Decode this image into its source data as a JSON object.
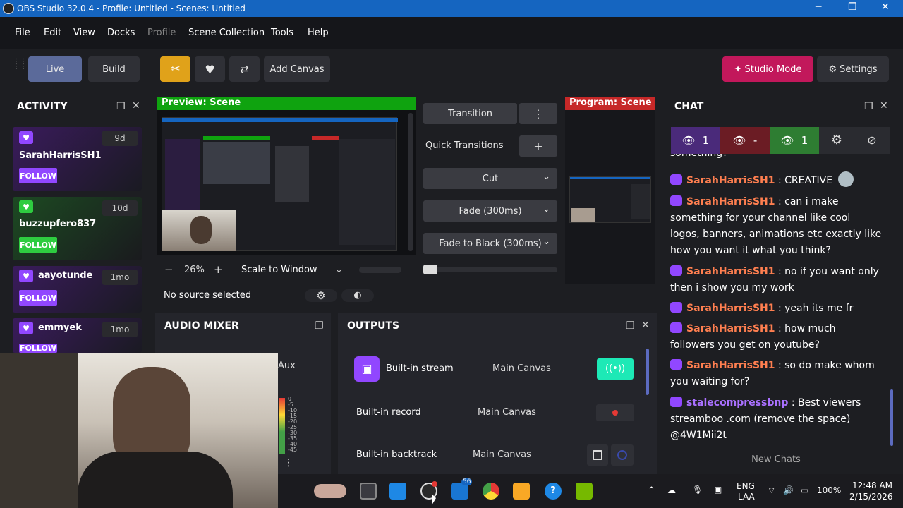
{
  "window": {
    "title": "OBS Studio 32.0.4 - Profile: Untitled - Scenes: Untitled",
    "minimize": "─",
    "restore": "❐",
    "close": "✕"
  },
  "menu": [
    "File",
    "Edit",
    "View",
    "Docks",
    "Profile",
    "Scene Collection",
    "Tools",
    "Help"
  ],
  "toolbar": {
    "live": "Live",
    "build": "Build",
    "add_canvas": "Add Canvas",
    "studio_mode": "Studio Mode",
    "settings": "Settings"
  },
  "activity": {
    "title": "ACTIVITY",
    "follow_label": "FOLLOW",
    "items": [
      {
        "name": "SarahHarrisSH1",
        "time": "9d"
      },
      {
        "name": "buzzupfero837",
        "time": "10d"
      },
      {
        "name": "aayotunde",
        "time": "1mo"
      },
      {
        "name": "emmyek",
        "time": "1mo"
      }
    ]
  },
  "preview": {
    "label": "Preview: Scene",
    "zoom": "26%",
    "zoom_minus": "−",
    "zoom_plus": "+",
    "scale_mode": "Scale to Window"
  },
  "program": {
    "label": "Program: Scene"
  },
  "transitions": {
    "transition": "Transition",
    "quick": "Quick Transitions",
    "add": "+",
    "cut": "Cut",
    "fade": "Fade (300ms)",
    "fade_black": "Fade to Black (300ms)"
  },
  "source_bar": {
    "no_source": "No source selected"
  },
  "audio_mixer": {
    "title": "AUDIO MIXER",
    "aux": "Aux",
    "scale": [
      "0",
      "-5",
      "-10",
      "-15",
      "-20",
      "-25",
      "-30",
      "-35",
      "-40",
      "-45"
    ]
  },
  "outputs": {
    "title": "OUTPUTS",
    "rows": [
      {
        "name": "Built-in stream",
        "canvas": "Main Canvas"
      },
      {
        "name": "Built-in record",
        "canvas": "Main Canvas"
      },
      {
        "name": "Built-in backtrack",
        "canvas": "Main Canvas"
      }
    ]
  },
  "chat": {
    "title": "CHAT",
    "viewers_1": "1",
    "viewers_2": "-",
    "viewers_3": "1",
    "partial": "something?",
    "messages": [
      {
        "user": "SarahHarrisSH1",
        "text": "CREATIVE"
      },
      {
        "user": "SarahHarrisSH1",
        "text": "can i make something for your channel like cool logos, banners, animations etc exactly like how you want it what you think?"
      },
      {
        "user": "SarahHarrisSH1",
        "text": "no if you want only then i show you my work"
      },
      {
        "user": "SarahHarrisSH1",
        "text": "yeah its me fr"
      },
      {
        "user": "SarahHarrisSH1",
        "text": "how much followers you get on youtube?"
      },
      {
        "user": "SarahHarrisSH1",
        "text": "so do make whom you waiting for?"
      },
      {
        "user": "stalecompressbnp",
        "text": "Best viewers streamboo .com (remove the space) @4W1Mii2t"
      }
    ],
    "new_chats": "New Chats"
  },
  "taskbar": {
    "lang1": "ENG",
    "lang2": "LAA",
    "battery": "100%",
    "time": "12:48 AM",
    "date": "2/15/2026",
    "badge": "56"
  },
  "colors": {
    "accent": "#9147ff",
    "preview_green": "#0fa30f",
    "program_red": "#c62828",
    "studio_mode": "#c2185b",
    "titlebar": "#1565c0"
  }
}
